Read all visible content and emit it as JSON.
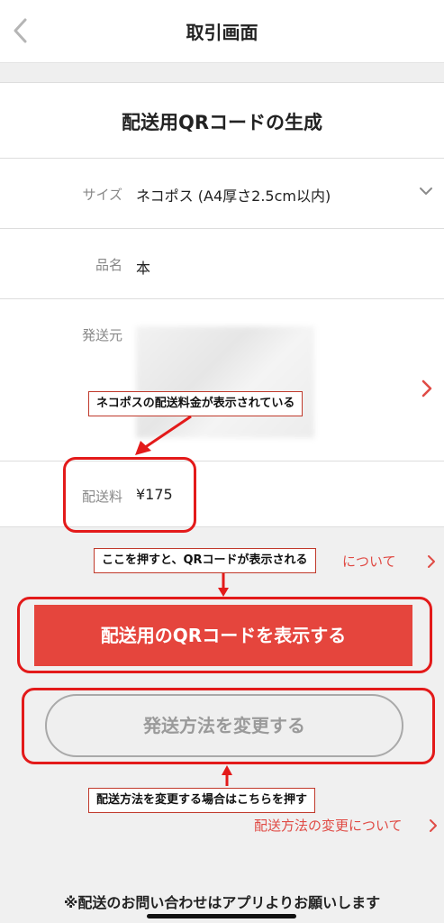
{
  "header": {
    "title": "取引画面",
    "back_icon": "chevron-left-icon"
  },
  "section": {
    "title": "配送用QRコードの生成"
  },
  "form": {
    "size": {
      "label": "サイズ",
      "value": "ネコポス (A4厚さ2.5cm以内)"
    },
    "item": {
      "label": "品名",
      "value": "本"
    },
    "from": {
      "label": "発送元"
    },
    "fee": {
      "label": "配送料",
      "value": "¥175"
    }
  },
  "links": {
    "partial": "について",
    "change_method": "配送方法の変更について"
  },
  "buttons": {
    "show_qr": "配送用のQRコードを表示する",
    "change_method": "発送方法を変更する"
  },
  "annotations": {
    "fee_note": "ネコポスの配送料金が表示されている",
    "qr_note": "ここを押すと、QRコードが表示される",
    "change_note": "配送方法を変更する場合はこちらを押す"
  },
  "footer": {
    "note": "※配送のお問い合わせはアプリよりお願いします"
  },
  "colors": {
    "accent": "#e5453d",
    "annotation": "#e31a1a"
  }
}
